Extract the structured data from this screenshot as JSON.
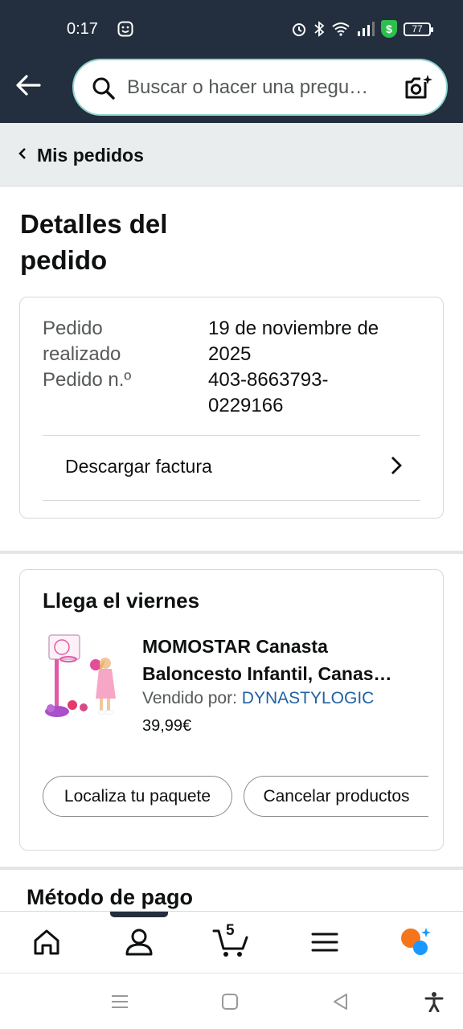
{
  "status_bar": {
    "time": "0:17",
    "battery": "77",
    "vpn_badge": "$"
  },
  "search": {
    "placeholder": "Buscar o hacer una pregu…"
  },
  "breadcrumb": {
    "label": "Mis pedidos"
  },
  "page": {
    "title": "Detalles del pedido"
  },
  "order_info": {
    "placed_label_line1": "Pedido",
    "placed_label_line2": "realizado",
    "placed_value_line1": "19 de noviembre de",
    "placed_value_line2": "2025",
    "number_label": "Pedido n.º",
    "number_value_line1": "403-8663793-",
    "number_value_line2": "0229166",
    "invoice_label": "Descargar factura"
  },
  "shipment": {
    "arrival": "Llega el viernes",
    "product_title_line1": "MOMOSTAR Canasta",
    "product_title_line2": "Baloncesto Infantil, Canas…",
    "seller_prefix": "Vendido por:",
    "seller_name": "DYNASTYLOGIC",
    "price": "39,99€",
    "track_button": "Localiza tu paquete",
    "cancel_button": "Cancelar productos"
  },
  "payment": {
    "title": "Método de pago"
  },
  "bottom_nav": {
    "cart_count": "5"
  },
  "colors": {
    "header_bg": "#232f3e",
    "link": "#2162a1",
    "search_border": "#8fd6d0",
    "assistant_orange": "#f5751d",
    "assistant_blue": "#1a98ff"
  }
}
